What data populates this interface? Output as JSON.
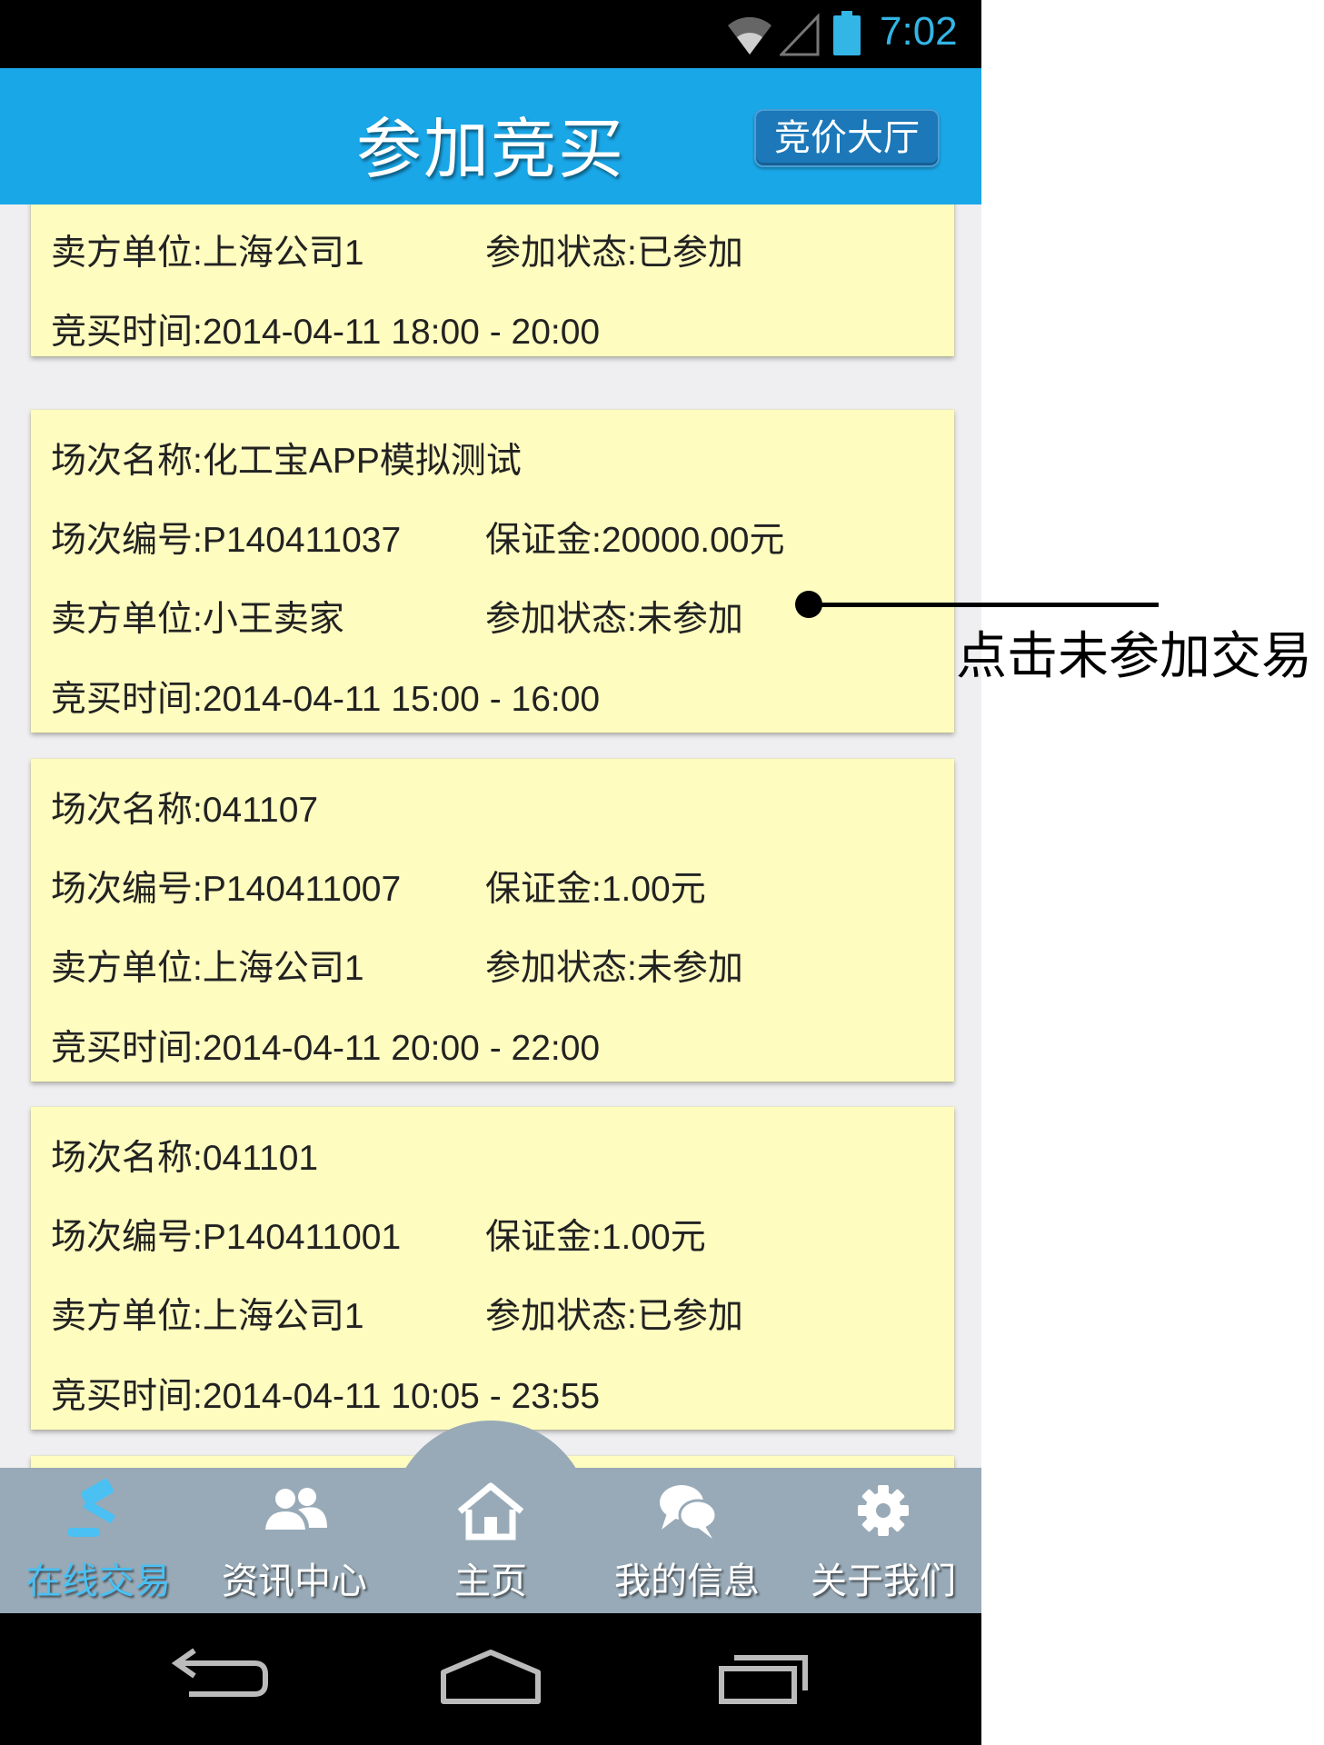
{
  "status_bar": {
    "time": "7:02",
    "time_color": "#33b5e5"
  },
  "header": {
    "title": "参加竞买",
    "hall_button": "竞价大厅",
    "color": "#1aa7e8"
  },
  "cards": [
    {
      "name": "",
      "code": "",
      "deposit": "",
      "seller": "卖方单位:上海公司1",
      "status": "参加状态:已参加",
      "time": "竞买时间:2014-04-11 18:00 - 20:00"
    },
    {
      "name": "场次名称:化工宝APP模拟测试",
      "code": "场次编号:P140411037",
      "deposit": "保证金:20000.00元",
      "seller": "卖方单位:小王卖家",
      "status": "参加状态:未参加",
      "time": "竞买时间:2014-04-11 15:00 - 16:00"
    },
    {
      "name": "场次名称:041107",
      "code": "场次编号:P140411007",
      "deposit": "保证金:1.00元",
      "seller": "卖方单位:上海公司1",
      "status": "参加状态:未参加",
      "time": "竞买时间:2014-04-11 20:00 - 22:00"
    },
    {
      "name": "场次名称:041101",
      "code": "场次编号:P140411001",
      "deposit": "保证金:1.00元",
      "seller": "卖方单位:上海公司1",
      "status": "参加状态:已参加",
      "time": "竞买时间:2014-04-11 10:05 - 23:55"
    }
  ],
  "card_color": "#fefcbf",
  "annotation": "点击未参加交易",
  "bottom_nav": {
    "items": [
      {
        "label": "在线交易",
        "icon": "gavel-icon",
        "active": true
      },
      {
        "label": "资讯中心",
        "icon": "users-icon",
        "active": false
      },
      {
        "label": "主页",
        "icon": "home-icon",
        "active": false
      },
      {
        "label": "我的信息",
        "icon": "chat-bubbles-icon",
        "active": false
      },
      {
        "label": "关于我们",
        "icon": "gear-icon",
        "active": false
      }
    ],
    "background": "#98aab7",
    "active_color": "#4ac0f3"
  },
  "system_nav": {
    "buttons": [
      "back-icon",
      "home-outline-icon",
      "recents-icon"
    ]
  }
}
